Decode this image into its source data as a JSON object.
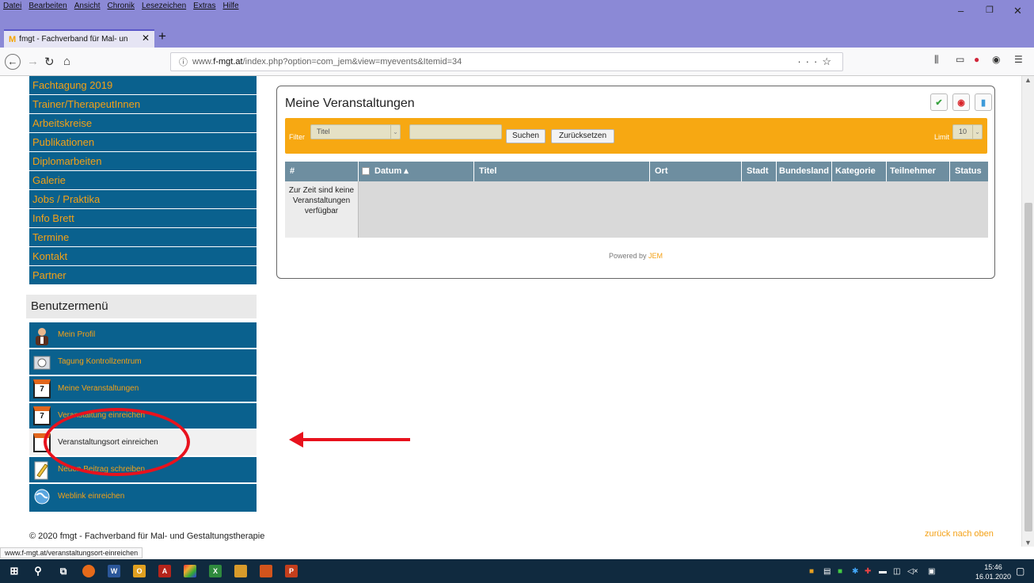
{
  "browser": {
    "menu": [
      "Datei",
      "Bearbeiten",
      "Ansicht",
      "Chronik",
      "Lesezeichen",
      "Extras",
      "Hilfe"
    ],
    "tab_title": "fmgt - Fachverband für Mal- un",
    "tab_favicon": "M",
    "url_prefix": "www.",
    "url_host": "f-mgt.at",
    "url_path": "/index.php?option=com_jem&view=myevents&Itemid=34",
    "status_url": "www.f-mgt.at/veranstaltungsort-einreichen"
  },
  "sidebar": {
    "nav_items": [
      "Fachtagung 2019",
      "Trainer/TherapeutInnen",
      "Arbeitskreise",
      "Publikationen",
      "Diplomarbeiten",
      "Galerie",
      "Jobs / Praktika",
      "Info Brett",
      "Termine",
      "Kontakt",
      "Partner"
    ],
    "user_menu_title": "Benutzermenü",
    "user_items": [
      "Mein Profil",
      "Tagung Kontrollzentrum",
      "Meine Veranstaltungen",
      "Veranstaltung einreichen",
      "Veranstaltungsort einreichen",
      "Neuen Beitrag schreiben",
      "Weblink einreichen"
    ],
    "calendar_day": "7"
  },
  "main": {
    "title": "Meine Veranstaltungen",
    "filter_label": "Filter",
    "filter_field": "Titel",
    "filter_text": "",
    "search_button": "Suchen",
    "reset_button": "Zurücksetzen",
    "limit_label": "Limit",
    "limit_value": "10",
    "columns": [
      "#",
      "Datum ▴",
      "Titel",
      "Ort",
      "Stadt",
      "Bundesland",
      "Kategorie",
      "Teilnehmer",
      "Status"
    ],
    "empty_message": "Zur Zeit sind keine Veranstaltungen verfügbar",
    "powered_by": "Powered by",
    "powered_link": "JEM"
  },
  "footer": {
    "copyright": "© 2020 fmgt - Fachverband für Mal- und Gestaltungstherapie",
    "back_to_top": "zurück nach oben"
  },
  "taskbar": {
    "time": "15:46",
    "date": "16.01.2020"
  },
  "colors": {
    "nav_bg": "#0a618e",
    "nav_text": "#f4a116",
    "filter_bg": "#f7a812",
    "table_header": "#6e8ea0",
    "annotation_red": "#e8121d"
  }
}
